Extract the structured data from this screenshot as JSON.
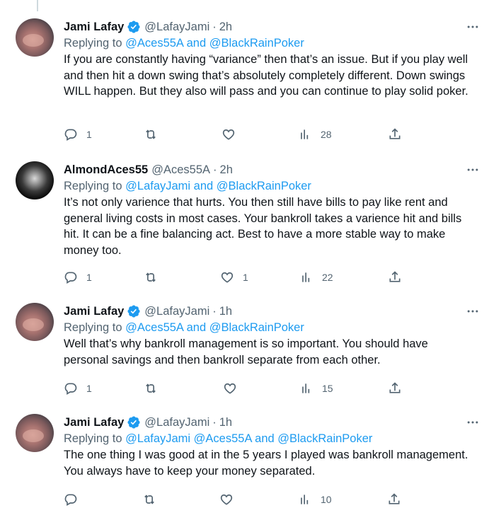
{
  "tweets": [
    {
      "name": "Jami Lafay",
      "handle": "@LafayJami",
      "time": "2h",
      "replying_prefix": "Replying to ",
      "replying_mentions": "@Aces55A and @BlackRainPoker",
      "text": "If you are constantly having “variance” then that’s an issue. But if you play well and then hit a down swing that’s absolutely completely different. Down swings WILL happen. But they also will pass and you can continue to play solid poker.",
      "replies": "1",
      "retweets": "",
      "likes": "",
      "views": "28",
      "verified": true
    },
    {
      "name": "AlmondAces55",
      "handle": "@Aces55A",
      "time": "2h",
      "replying_prefix": "Replying to ",
      "replying_mentions": "@LafayJami and @BlackRainPoker",
      "text": "It’s not only varience that hurts. You then still have bills to pay like rent and general living costs in most cases. Your bankroll takes a varience hit and bills hit. It can be a fine balancing act. Best to have a more stable way to make money too.",
      "replies": "1",
      "retweets": "",
      "likes": "1",
      "views": "22",
      "verified": false
    },
    {
      "name": "Jami Lafay",
      "handle": "@LafayJami",
      "time": "1h",
      "replying_prefix": "Replying to ",
      "replying_mentions": "@Aces55A and @BlackRainPoker",
      "text": "Well that’s why bankroll management is so important. You should have personal savings and then bankroll separate from each other.",
      "replies": "1",
      "retweets": "",
      "likes": "",
      "views": "15",
      "verified": true
    },
    {
      "name": "Jami Lafay",
      "handle": "@LafayJami",
      "time": "1h",
      "replying_prefix": "Replying to ",
      "replying_mentions": "@LafayJami @Aces55A and @BlackRainPoker",
      "text": "The one thing I was good at in the 5 years I played was bankroll management. You always have to keep your money separated.",
      "replies": "",
      "retweets": "",
      "likes": "",
      "views": "10",
      "verified": true
    }
  ],
  "colors": {
    "text": "#0f1419",
    "secondary": "#536471",
    "link": "#1d9bf0",
    "verified": "#1d9bf0",
    "thread_line": "#cfd9de"
  },
  "icons": {
    "reply": "reply-icon",
    "retweet": "retweet-icon",
    "like": "like-icon",
    "views": "views-icon",
    "share": "share-icon",
    "more": "more-icon",
    "verified": "verified-badge-icon"
  }
}
